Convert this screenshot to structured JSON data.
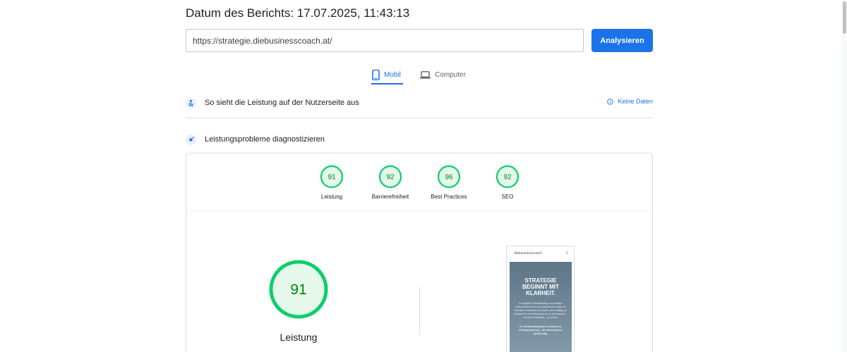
{
  "report": {
    "date_label": "Datum des Berichts: 17.07.2025, 11:43:13"
  },
  "search": {
    "url_value": "https://strategie.diebusinesscoach.at/",
    "button_label": "Analysieren"
  },
  "tabs": [
    {
      "label": "Mobil",
      "icon": "smartphone-icon",
      "active": true
    },
    {
      "label": "Computer",
      "icon": "laptop-icon",
      "active": false
    }
  ],
  "field_data": {
    "title": "So sieht die Leistung auf der Nutzerseite aus",
    "no_data_label": "Keine Daten"
  },
  "diagnostics": {
    "title": "Leistungsprobleme diagnostizieren"
  },
  "scores": [
    {
      "label": "Leistung",
      "value": 91
    },
    {
      "label": "Barrierefreiheit",
      "value": 92
    },
    {
      "label": "Best Practices",
      "value": 96
    },
    {
      "label": "SEO",
      "value": 92
    }
  ],
  "performance": {
    "score": 91,
    "label": "Leistung"
  },
  "preview": {
    "logo_text": "diebusinesscoach",
    "headline": "STRATEGIE BEGINNT MIT KLARHEIT.",
    "body": "Ich begleite Selbstständige und kreative Unternehmerinnen und Unternehmer dabei, ihr Vorhaben strukturiert zu planen, sich entlang zu priorisieren und Ressourcen so zu einzusetzen – und nicht blindlings – zu nutzen.",
    "body2": "KI, Schlüsselkompetenz Strukturen, Strategieplanung – das alles passiert gleichzeitig."
  },
  "colors": {
    "accent": "#1a73e8",
    "pass": "#0cce6b",
    "pass_text": "#008800",
    "pass_fill": "#e6f7ec"
  }
}
